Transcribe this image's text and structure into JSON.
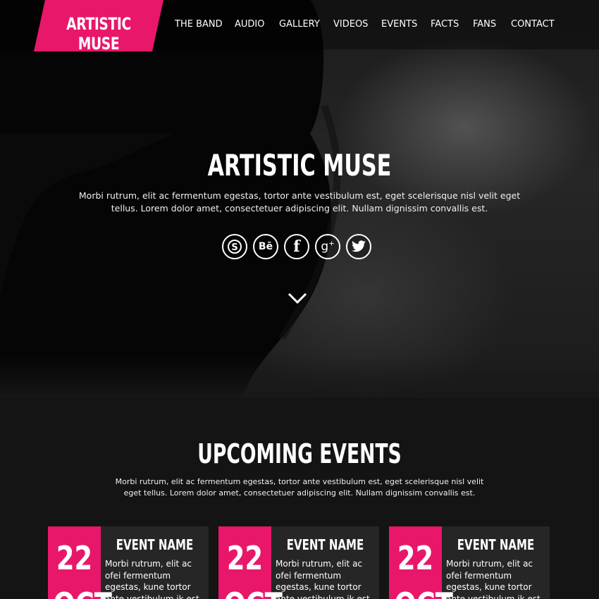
{
  "brand": {
    "name": "ARTISTIC MUSE",
    "accent_color": "#e8176a"
  },
  "nav": {
    "items": [
      "THE BAND",
      "AUDIO",
      "GALLERY",
      "VIDEOS",
      "EVENTS",
      "FACTS",
      "FANS",
      "CONTACT"
    ]
  },
  "hero": {
    "title": "ARTISTIC MUSE",
    "text": "Morbi rutrum, elit ac fermentum egestas, tortor ante vestibulum est, eget scelerisque nisl velit eget tellus. Lorem dolor amet, consectetuer adipiscing elit. Nullam dignissim convallis est.",
    "socials": [
      {
        "icon": "skype-icon",
        "label": "S"
      },
      {
        "icon": "behance-icon",
        "label": "Bē"
      },
      {
        "icon": "facebook-icon",
        "label": "f"
      },
      {
        "icon": "google-plus-icon",
        "label": "g+"
      },
      {
        "icon": "twitter-icon",
        "label": ""
      }
    ],
    "scroll_icon": "chevron-down-icon"
  },
  "events": {
    "title": "UPCOMING EVENTS",
    "text": "Morbi rutrum, elit ac fermentum egestas, tortor ante vestibulum est, eget scelerisque nisl velit eget tellus. Lorem dolor amet, consectetuer adipiscing elit. Nullam dignissim convallis est.",
    "cards": [
      {
        "day": "22",
        "month": "OCT",
        "name": "EVENT NAME",
        "desc": "Morbi rutrum, elit ac ofei fermentum egestas, kune tortor ante vestibulum ik est"
      },
      {
        "day": "22",
        "month": "OCT",
        "name": "EVENT NAME",
        "desc": "Morbi rutrum, elit ac ofei fermentum egestas, kune tortor ante vestibulum ik est"
      },
      {
        "day": "22",
        "month": "OCT",
        "name": "EVENT NAME",
        "desc": "Morbi rutrum, elit ac ofei fermentum egestas, kune tortor ante vestibulum ik est"
      }
    ]
  }
}
